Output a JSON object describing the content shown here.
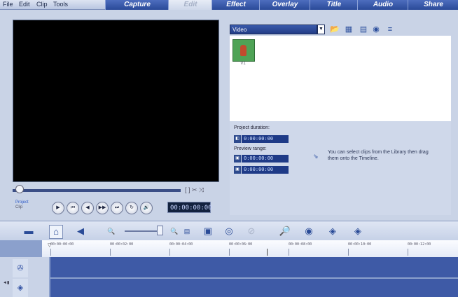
{
  "menu": [
    "File",
    "Edit",
    "Clip",
    "Tools"
  ],
  "steps": [
    {
      "label": "Capture",
      "active": true
    },
    {
      "label": "Edit",
      "active": false
    },
    {
      "label": "Effect",
      "active": true
    },
    {
      "label": "Overlay",
      "active": true
    },
    {
      "label": "Title",
      "active": true
    },
    {
      "label": "Audio",
      "active": true
    },
    {
      "label": "Share",
      "active": true
    }
  ],
  "player": {
    "project_label": "Project",
    "clip_label": "Clip",
    "trim_marks": "[  ]  ✂  ⤨",
    "timecode": "00:00:00:00",
    "buttons": [
      "▶",
      "⏮",
      "◀",
      "▶▶",
      "⏭",
      "↻",
      "🔊"
    ]
  },
  "library": {
    "category": "Video",
    "dropdown_icon": "▼",
    "icons": [
      "folder-icon",
      "storyboard-icon",
      "options-icon",
      "play-clip-icon",
      "menu-icon"
    ],
    "icon_glyphs": [
      "📂",
      "▦",
      "▤",
      "◉",
      "≡"
    ],
    "clip_name": "V1"
  },
  "info": {
    "project_duration_label": "Project duration:",
    "project_duration": "0:00:00:00",
    "preview_range_label": "Preview range:",
    "preview_start": "0:00:00:00",
    "preview_end": "0:00:00:00",
    "hint": "You can select clips from the Library then drag them onto the Timeline."
  },
  "timeline_toolbar": {
    "icon_glyphs": [
      "▬",
      "⌂",
      "◀",
      "🔍",
      "🔍",
      "▤",
      "▣",
      "◎",
      "⊘",
      "🔎",
      "◉",
      "◈",
      "◈"
    ]
  },
  "ruler": {
    "ticks": [
      "00:00:00:00",
      "00:00:02:00",
      "00:00:04:00",
      "00:00:06:00",
      "00:00:08:00",
      "00:00:10:00",
      "00:00:12:00"
    ],
    "playhead": "▽"
  },
  "tracks": {
    "video_icon": "✇",
    "overlay_icon": "◈",
    "toggle": "◄▮"
  },
  "colors": {
    "accent": "#2a4a98",
    "track": "#3e5aa6"
  }
}
